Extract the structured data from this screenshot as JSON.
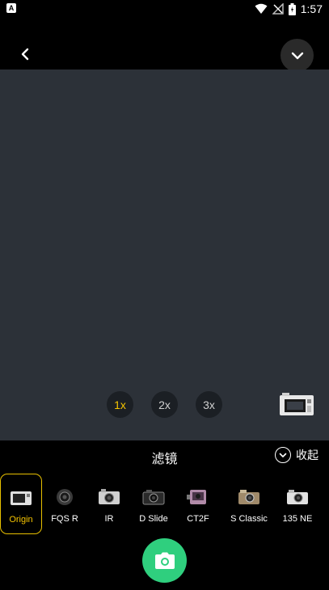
{
  "status_bar": {
    "time": "1:57",
    "left_icon": "notification-a-icon",
    "icons": [
      "wifi-icon",
      "no-signal-icon",
      "battery-icon"
    ]
  },
  "top_bar": {
    "back_icon": "chevron-left-icon",
    "dropdown_icon": "chevron-down-icon"
  },
  "zoom": {
    "options": [
      "1x",
      "2x",
      "3x"
    ],
    "selected": "1x"
  },
  "filter_panel": {
    "title": "滤镜",
    "collapse_label": "收起",
    "filters": [
      {
        "label": "Origin",
        "selected": true
      },
      {
        "label": "FQS R"
      },
      {
        "label": "IR"
      },
      {
        "label": "D Slide"
      },
      {
        "label": "CT2F"
      },
      {
        "label": "S Classic"
      },
      {
        "label": "135 NE"
      }
    ]
  },
  "colors": {
    "accent": "#f5c400",
    "shutter": "#2fcf7e",
    "preview_bg": "#2c3138"
  }
}
